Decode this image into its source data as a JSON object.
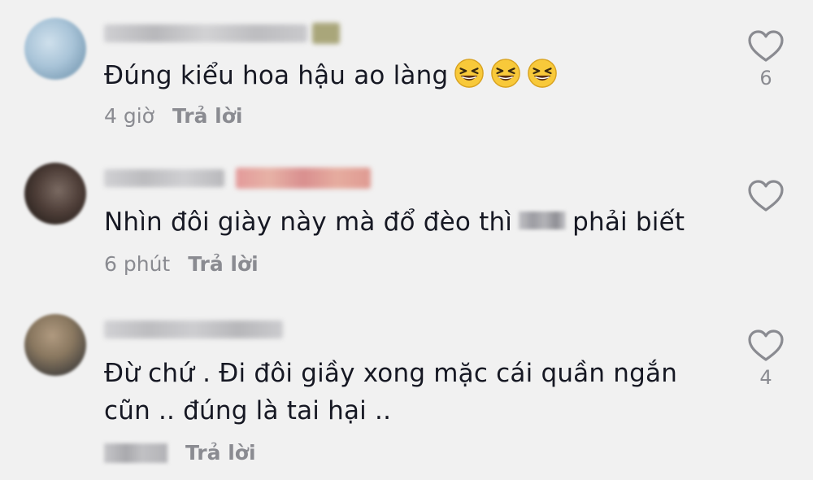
{
  "comments": [
    {
      "text": "Đúng kiểu hoa hậu ao làng",
      "emoji": [
        "laughing-face",
        "laughing-face",
        "laughing-face"
      ],
      "time": "4 giờ",
      "reply_label": "Trả lời",
      "like_count": "6"
    },
    {
      "text_before": "Nhìn đôi giày này mà đổ đèo thì",
      "text_after": "phải biết",
      "time": "6 phút",
      "reply_label": "Trả lời",
      "like_count": ""
    },
    {
      "text_line1": "Đừ chứ . Đi đôi giầy xong mặc cái quần ngắn",
      "text_line2": "cũn .. đúng là tai hại ..",
      "reply_label": "Trả lời",
      "like_count": "4"
    }
  ],
  "colors": {
    "background": "#f1f1f1",
    "text": "#161823",
    "meta": "#8a8b91",
    "heart": "#8a8b91"
  },
  "icons": {
    "like": "heart-outline-icon",
    "emoji": "laughing-face"
  }
}
